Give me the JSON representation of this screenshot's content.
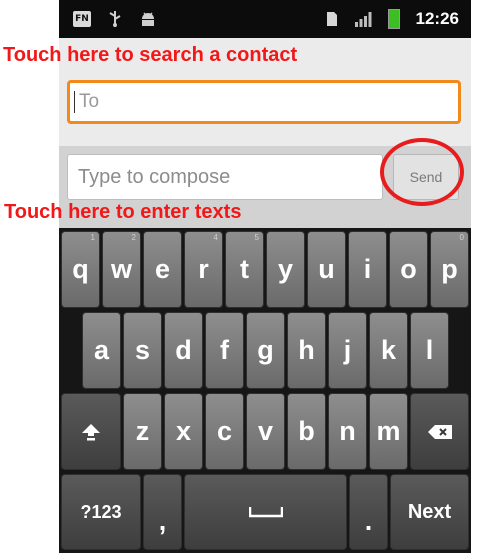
{
  "status_bar": {
    "time": "12:26",
    "icons": [
      "fn-icon",
      "usb-icon",
      "android-debug-icon",
      "sim-icon",
      "signal-icon",
      "battery-icon"
    ]
  },
  "annotations": {
    "search": "Touch here to search a contact",
    "texts": "Touch here to enter texts"
  },
  "to_field": {
    "placeholder": "To",
    "value": ""
  },
  "compose_field": {
    "placeholder": "Type to compose",
    "value": ""
  },
  "send_label": "Send",
  "keyboard": {
    "row1": [
      "q",
      "w",
      "e",
      "r",
      "t",
      "y",
      "u",
      "i",
      "o",
      "p"
    ],
    "row1_hints": [
      "1",
      "2",
      "",
      "4",
      "5",
      "",
      "",
      "",
      "",
      "0"
    ],
    "row2": [
      "a",
      "s",
      "d",
      "f",
      "g",
      "h",
      "j",
      "k",
      "l"
    ],
    "row3": [
      "z",
      "x",
      "c",
      "v",
      "b",
      "n",
      "m"
    ],
    "shift_icon": "shift-icon",
    "delete_icon": "backspace-icon",
    "symbols_label": "?123",
    "comma_label": ",",
    "space_icon": "space-icon",
    "period_label": ".",
    "next_label": "Next"
  },
  "colors": {
    "annotation": "#f21818",
    "focus_border": "#f28a1b",
    "highlight_circle": "#e81c1c",
    "battery": "#3cbf22"
  }
}
